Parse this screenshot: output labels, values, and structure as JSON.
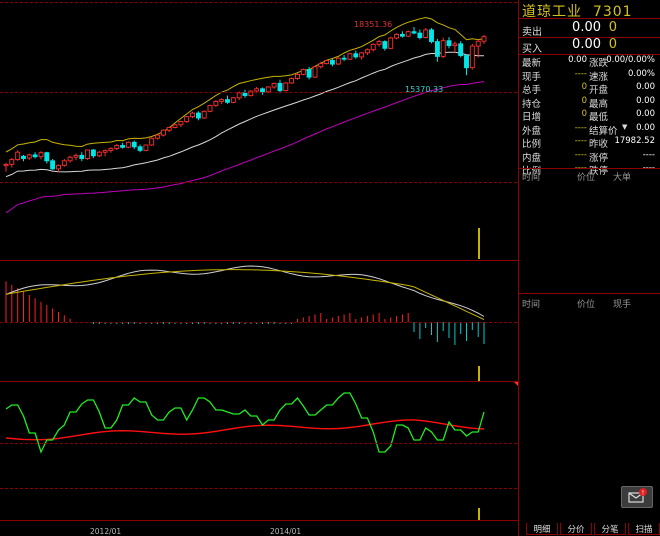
{
  "stock": {
    "name": "道琼工业",
    "code": "7301"
  },
  "quote": {
    "sell_label": "卖出",
    "sell_price": "0.00",
    "sell_volume": "0",
    "buy_label": "买入",
    "buy_price": "0.00",
    "buy_volume": "0"
  },
  "stats": [
    {
      "l1": "最新",
      "v1": "0.00",
      "c1": "#ffffff",
      "l2": "涨跌",
      "v2": "0.00/0.00%"
    },
    {
      "l1": "现手",
      "v1": "----",
      "c1": "#d4c21a",
      "l2": "速涨",
      "v2": "0.00%"
    },
    {
      "l1": "总手",
      "v1": "0",
      "c1": "#d4c21a",
      "l2": "开盘",
      "v2": "0.00"
    },
    {
      "l1": "持仓",
      "v1": "0",
      "c1": "#d4c21a",
      "l2": "最高",
      "v2": "0.00"
    },
    {
      "l1": "日增",
      "v1": "0",
      "c1": "#d4c21a",
      "l2": "最低",
      "v2": "0.00"
    },
    {
      "l1": "外盘",
      "v1": "----",
      "c1": "#d4c21a",
      "l2": "结算价",
      "v2": "0.00",
      "dropdown": true
    },
    {
      "l1": "比例",
      "v1": "----",
      "c1": "#d4c21a",
      "l2": "昨收",
      "v2": "17982.52"
    },
    {
      "l1": "内盘",
      "v1": "----",
      "c1": "#d4c21a",
      "l2": "涨停",
      "v2": "----"
    },
    {
      "l1": "比例",
      "v1": "----",
      "c1": "#d4c21a",
      "l2": "跌停",
      "v2": "----"
    }
  ],
  "ticks_header": {
    "time": "时间",
    "price": "价位",
    "big": "大单"
  },
  "trades_header": {
    "time": "时间",
    "price": "价位",
    "volume": "现手"
  },
  "tabs": [
    "明细",
    "分价",
    "分笔",
    "扫描"
  ],
  "chart_data": {
    "type": "candlestick",
    "x_labels": [
      "2012/01",
      "2014/01"
    ],
    "high_label": "18351.36",
    "low_label": "15370.33",
    "candles": [
      [
        12.18,
        12.3,
        11.92,
        12.24
      ],
      [
        12.24,
        12.52,
        12.1,
        12.45
      ],
      [
        12.45,
        12.86,
        12.4,
        12.78
      ],
      [
        12.6,
        12.66,
        12.38,
        12.5
      ],
      [
        12.52,
        12.72,
        12.44,
        12.66
      ],
      [
        12.66,
        12.78,
        12.5,
        12.58
      ],
      [
        12.58,
        12.82,
        12.46,
        12.76
      ],
      [
        12.76,
        12.8,
        12.28,
        12.4
      ],
      [
        12.4,
        12.48,
        12.0,
        12.04
      ],
      [
        12.04,
        12.24,
        11.9,
        12.2
      ],
      [
        12.2,
        12.48,
        12.14,
        12.4
      ],
      [
        12.4,
        12.62,
        12.32,
        12.56
      ],
      [
        12.56,
        12.72,
        12.42,
        12.64
      ],
      [
        12.64,
        12.78,
        12.38,
        12.5
      ],
      [
        12.5,
        12.9,
        12.44,
        12.88
      ],
      [
        12.88,
        12.92,
        12.52,
        12.62
      ],
      [
        12.62,
        12.84,
        12.56,
        12.78
      ],
      [
        12.78,
        12.9,
        12.6,
        12.86
      ],
      [
        12.86,
        13.0,
        12.76,
        12.94
      ],
      [
        12.94,
        13.14,
        12.88,
        13.08
      ],
      [
        13.08,
        13.2,
        12.94,
        13.0
      ],
      [
        13.0,
        13.26,
        12.96,
        13.22
      ],
      [
        13.22,
        13.3,
        12.92,
        13.02
      ],
      [
        13.02,
        13.12,
        12.78,
        12.86
      ],
      [
        12.86,
        13.12,
        12.82,
        13.1
      ],
      [
        13.1,
        13.44,
        13.06,
        13.4
      ],
      [
        13.4,
        13.58,
        13.34,
        13.54
      ],
      [
        13.54,
        13.8,
        13.48,
        13.76
      ],
      [
        13.76,
        13.92,
        13.68,
        13.88
      ],
      [
        13.88,
        14.02,
        13.84,
        14.0
      ],
      [
        14.0,
        14.18,
        13.9,
        14.14
      ],
      [
        14.14,
        14.4,
        14.08,
        14.36
      ],
      [
        14.36,
        14.58,
        14.3,
        14.52
      ],
      [
        14.52,
        14.6,
        14.2,
        14.3
      ],
      [
        14.3,
        14.64,
        14.26,
        14.6
      ],
      [
        14.6,
        14.9,
        14.56,
        14.86
      ],
      [
        14.86,
        15.1,
        14.8,
        15.04
      ],
      [
        15.04,
        15.18,
        14.92,
        15.12
      ],
      [
        15.12,
        15.3,
        14.94,
        15.0
      ],
      [
        15.0,
        15.24,
        14.96,
        15.2
      ],
      [
        15.2,
        15.48,
        15.1,
        15.42
      ],
      [
        15.42,
        15.56,
        15.2,
        15.3
      ],
      [
        15.3,
        15.54,
        15.26,
        15.5
      ],
      [
        15.5,
        15.68,
        15.4,
        15.6
      ],
      [
        15.6,
        15.66,
        15.34,
        15.46
      ],
      [
        15.46,
        15.72,
        15.42,
        15.68
      ],
      [
        15.68,
        15.88,
        15.6,
        15.84
      ],
      [
        15.84,
        16.0,
        15.4,
        15.52
      ],
      [
        15.52,
        15.9,
        15.48,
        15.86
      ],
      [
        15.86,
        16.1,
        15.82,
        16.06
      ],
      [
        16.06,
        16.3,
        16.0,
        16.24
      ],
      [
        16.24,
        16.5,
        16.2,
        16.46
      ],
      [
        16.46,
        16.58,
        16.02,
        16.12
      ],
      [
        16.12,
        16.62,
        16.08,
        16.58
      ],
      [
        16.58,
        16.8,
        16.5,
        16.72
      ],
      [
        16.72,
        16.9,
        16.68,
        16.86
      ],
      [
        16.86,
        16.94,
        16.6,
        16.7
      ],
      [
        16.7,
        17.0,
        16.66,
        16.96
      ],
      [
        16.96,
        17.1,
        16.84,
        16.92
      ],
      [
        16.92,
        17.2,
        16.88,
        17.16
      ],
      [
        17.16,
        17.3,
        16.94,
        17.02
      ],
      [
        17.02,
        17.24,
        16.9,
        17.2
      ],
      [
        17.2,
        17.4,
        17.1,
        17.34
      ],
      [
        17.34,
        17.62,
        17.26,
        17.58
      ],
      [
        17.58,
        17.78,
        17.48,
        17.7
      ],
      [
        17.7,
        17.76,
        17.3,
        17.4
      ],
      [
        17.4,
        17.92,
        17.36,
        17.86
      ],
      [
        17.86,
        18.08,
        17.8,
        18.02
      ],
      [
        18.02,
        18.16,
        17.88,
        17.94
      ],
      [
        17.94,
        18.2,
        17.9,
        18.14
      ],
      [
        18.14,
        18.35,
        18.02,
        18.08
      ],
      [
        18.08,
        18.24,
        17.8,
        17.88
      ],
      [
        17.88,
        18.3,
        17.84,
        18.22
      ],
      [
        18.22,
        18.3,
        17.62,
        17.7
      ],
      [
        17.7,
        17.82,
        16.8,
        17.04
      ],
      [
        17.04,
        17.88,
        16.96,
        17.74
      ],
      [
        17.74,
        17.9,
        17.4,
        17.52
      ],
      [
        17.52,
        17.7,
        17.2,
        17.6
      ],
      [
        17.6,
        17.72,
        17.0,
        17.08
      ],
      [
        17.08,
        17.14,
        16.2,
        16.54
      ],
      [
        16.54,
        17.6,
        16.46,
        17.5
      ],
      [
        17.5,
        17.8,
        17.0,
        17.72
      ],
      [
        17.72,
        18.0,
        17.6,
        17.92
      ]
    ]
  }
}
